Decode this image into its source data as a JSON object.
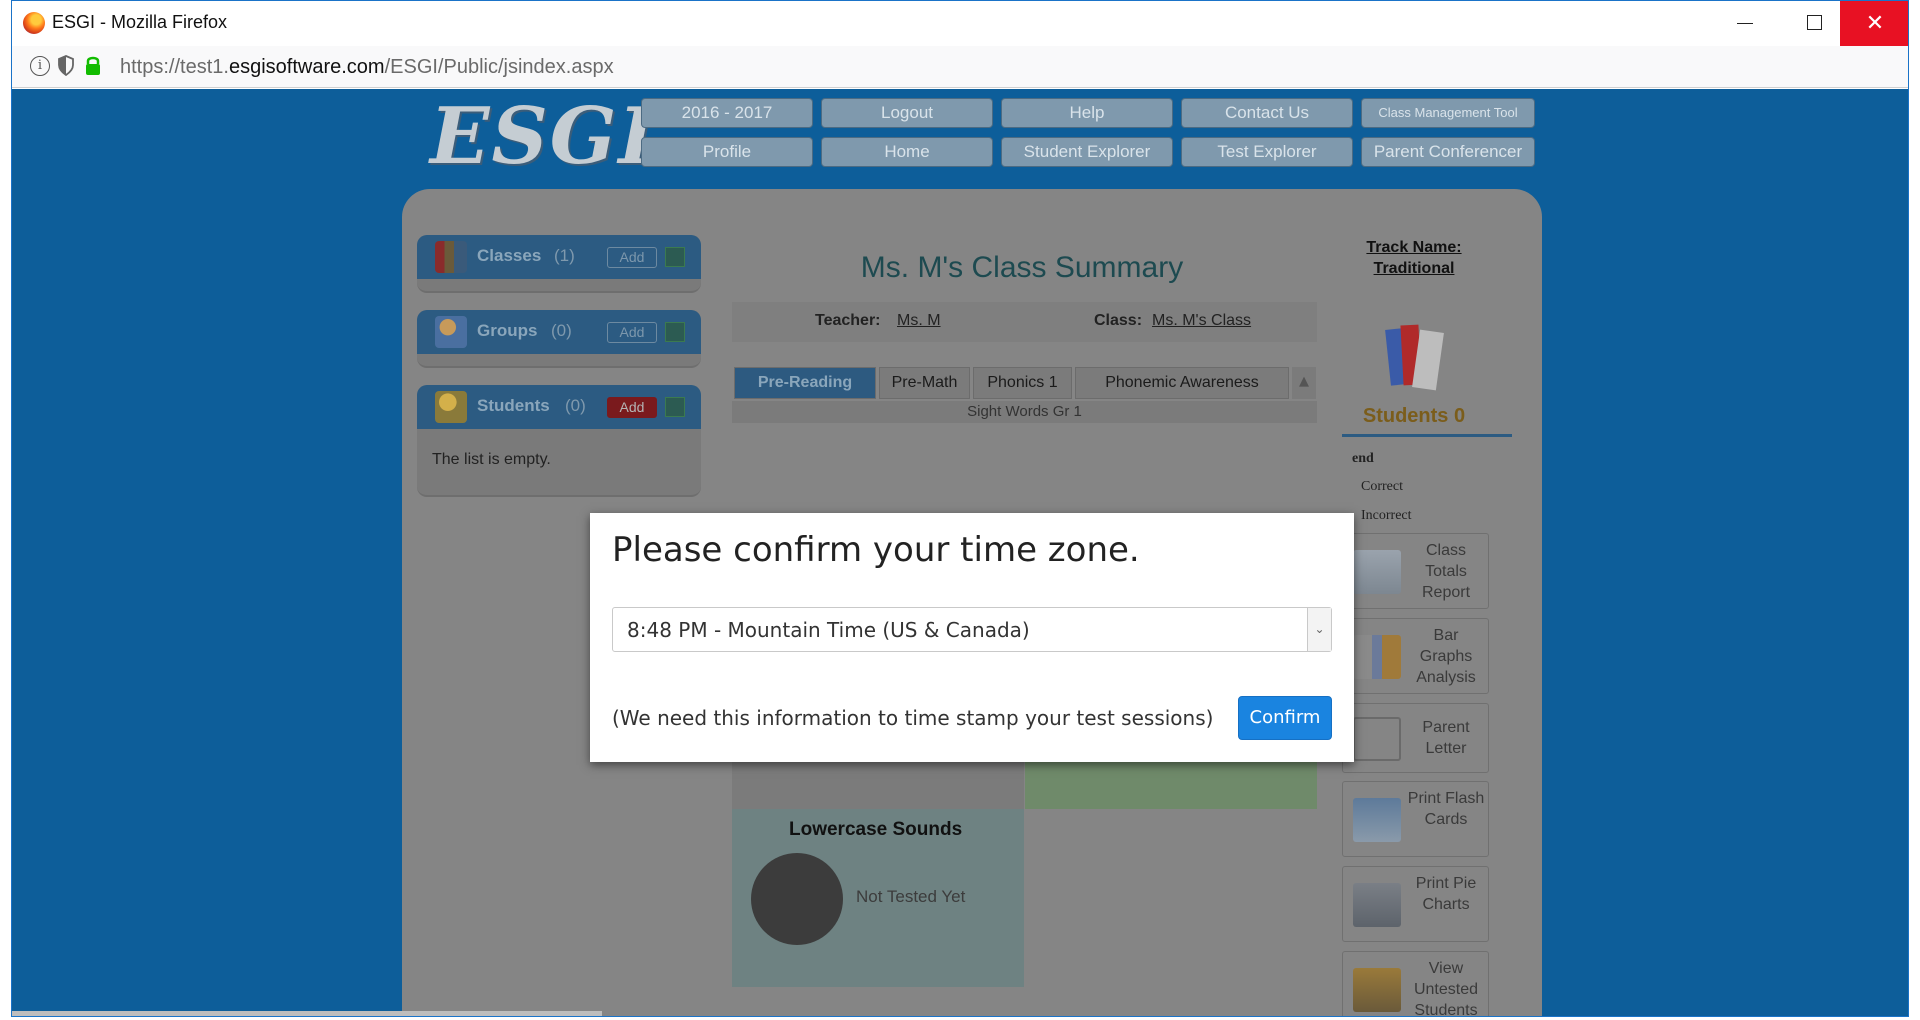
{
  "browser": {
    "window_title": "ESGI - Mozilla Firefox",
    "url_prefix": "https://test1.",
    "url_domain": "esgisoftware.com",
    "url_path": "/ESGI/Public/jsindex.aspx",
    "controls": {
      "minimize": "—",
      "maximize": "☐",
      "close": "✕"
    }
  },
  "logo_text": "ESGI",
  "nav": {
    "row1": [
      "2016 - 2017",
      "Logout",
      "Help",
      "Contact Us",
      "Class Management Tool"
    ],
    "row2": [
      "Profile",
      "Home",
      "Student Explorer",
      "Test Explorer",
      "Parent Conferencer"
    ]
  },
  "sidebar": {
    "classes": {
      "title": "Classes",
      "count": "(1)",
      "add": "Add"
    },
    "groups": {
      "title": "Groups",
      "count": "(0)",
      "add": "Add"
    },
    "students": {
      "title": "Students",
      "count": "(0)",
      "add": "Add",
      "empty": "The list is empty."
    }
  },
  "summary": {
    "title": "Ms. M's Class Summary",
    "teacher_label": "Teacher:",
    "teacher_value": "Ms. M",
    "class_label": "Class:",
    "class_value": "Ms. M's Class",
    "tabs": [
      "Pre-Reading",
      "Pre-Math",
      "Phonics 1",
      "Phonemic Awareness"
    ],
    "tab_row2": "Sight Words Gr 1",
    "not_tested": "Not Tested Yet",
    "lowercase_title": "Lowercase Sounds"
  },
  "right": {
    "track_line1": "Track Name:",
    "track_line2": "Traditional",
    "students": "Students 0",
    "legend": "end",
    "correct": "Correct",
    "incorrect": "Incorrect",
    "buttons": [
      "Class Totals Report",
      "Bar Graphs Analysis",
      "Parent Letter",
      "Print Flash Cards",
      "Print Pie Charts",
      "View Untested Students"
    ]
  },
  "modal": {
    "title": "Please confirm your time zone.",
    "selected": "8:48 PM - Mountain Time (US & Canada)",
    "note": "(We need this information to time stamp your test sessions)",
    "confirm": "Confirm"
  }
}
